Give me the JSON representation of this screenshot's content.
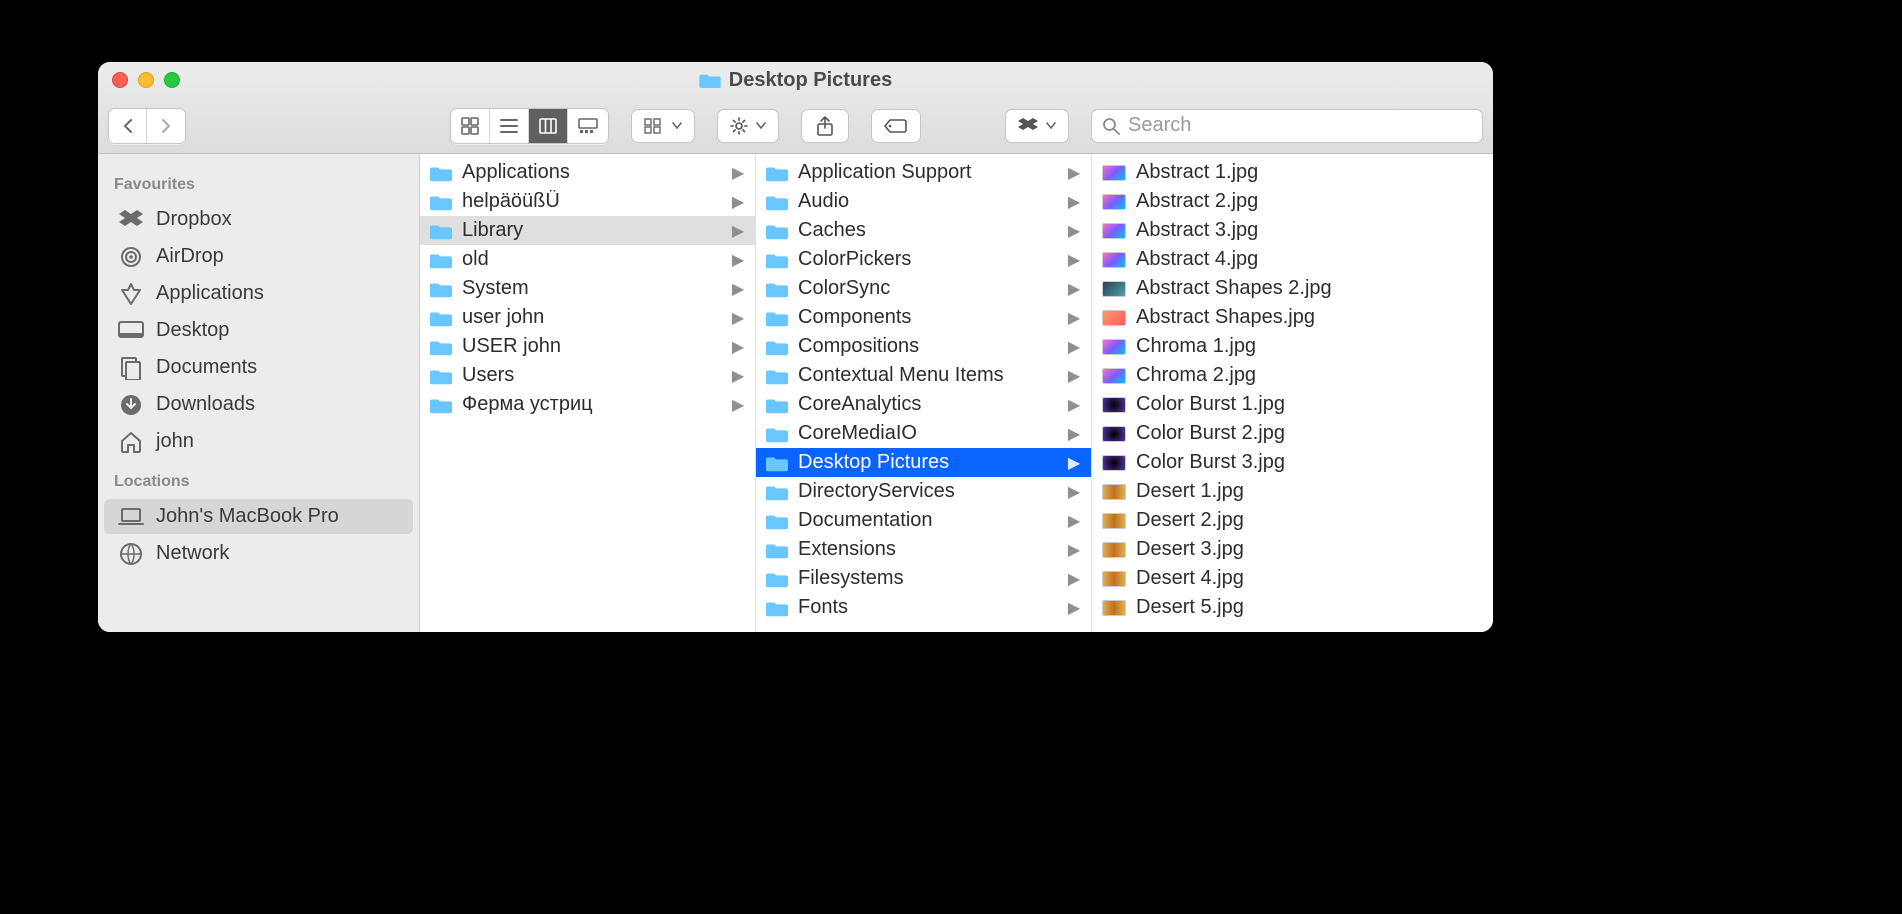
{
  "window": {
    "title": "Desktop Pictures"
  },
  "search": {
    "placeholder": "Search"
  },
  "sidebar": {
    "sections": [
      {
        "heading": "Favourites",
        "items": [
          {
            "icon": "dropbox",
            "label": "Dropbox"
          },
          {
            "icon": "airdrop",
            "label": "AirDrop"
          },
          {
            "icon": "apps",
            "label": "Applications"
          },
          {
            "icon": "desktop",
            "label": "Desktop"
          },
          {
            "icon": "docs",
            "label": "Documents"
          },
          {
            "icon": "downloads",
            "label": "Downloads"
          },
          {
            "icon": "home",
            "label": "john"
          }
        ]
      },
      {
        "heading": "Locations",
        "items": [
          {
            "icon": "laptop",
            "label": "John's MacBook Pro",
            "selected": true
          },
          {
            "icon": "globe",
            "label": "Network"
          }
        ]
      }
    ]
  },
  "columns": [
    {
      "items": [
        {
          "type": "folder",
          "label": "Applications"
        },
        {
          "type": "folder",
          "label": "helpäöüßÜ"
        },
        {
          "type": "folder",
          "label": "Library",
          "selected": "dim"
        },
        {
          "type": "folder",
          "label": "old"
        },
        {
          "type": "folder",
          "label": "System"
        },
        {
          "type": "folder",
          "label": "user john"
        },
        {
          "type": "folder",
          "label": "USER john"
        },
        {
          "type": "folder",
          "label": "Users"
        },
        {
          "type": "folder",
          "label": "Ферма устриц"
        }
      ]
    },
    {
      "items": [
        {
          "type": "folder",
          "label": "Application Support"
        },
        {
          "type": "folder",
          "label": "Audio"
        },
        {
          "type": "folder",
          "label": "Caches"
        },
        {
          "type": "folder",
          "label": "ColorPickers"
        },
        {
          "type": "folder",
          "label": "ColorSync"
        },
        {
          "type": "folder",
          "label": "Components"
        },
        {
          "type": "folder",
          "label": "Compositions"
        },
        {
          "type": "folder",
          "label": "Contextual Menu Items"
        },
        {
          "type": "folder",
          "label": "CoreAnalytics"
        },
        {
          "type": "folder",
          "label": "CoreMediaIO"
        },
        {
          "type": "folder",
          "label": "Desktop Pictures",
          "selected": "active"
        },
        {
          "type": "folder",
          "label": "DirectoryServices"
        },
        {
          "type": "folder",
          "label": "Documentation"
        },
        {
          "type": "folder",
          "label": "Extensions"
        },
        {
          "type": "folder",
          "label": "Filesystems"
        },
        {
          "type": "folder",
          "label": "Fonts"
        }
      ]
    },
    {
      "items": [
        {
          "type": "image",
          "thumb": "t1",
          "label": "Abstract 1.jpg"
        },
        {
          "type": "image",
          "thumb": "t1",
          "label": "Abstract 2.jpg"
        },
        {
          "type": "image",
          "thumb": "t1",
          "label": "Abstract 3.jpg"
        },
        {
          "type": "image",
          "thumb": "t1",
          "label": "Abstract 4.jpg"
        },
        {
          "type": "image",
          "thumb": "t5",
          "label": "Abstract Shapes 2.jpg"
        },
        {
          "type": "image",
          "thumb": "t2",
          "label": "Abstract Shapes.jpg"
        },
        {
          "type": "image",
          "thumb": "t1",
          "label": "Chroma 1.jpg"
        },
        {
          "type": "image",
          "thumb": "t1",
          "label": "Chroma 2.jpg"
        },
        {
          "type": "image",
          "thumb": "t3",
          "label": "Color Burst 1.jpg"
        },
        {
          "type": "image",
          "thumb": "t3",
          "label": "Color Burst 2.jpg"
        },
        {
          "type": "image",
          "thumb": "t3",
          "label": "Color Burst 3.jpg"
        },
        {
          "type": "image",
          "thumb": "t4",
          "label": "Desert 1.jpg"
        },
        {
          "type": "image",
          "thumb": "t4",
          "label": "Desert 2.jpg"
        },
        {
          "type": "image",
          "thumb": "t4",
          "label": "Desert 3.jpg"
        },
        {
          "type": "image",
          "thumb": "t4",
          "label": "Desert 4.jpg"
        },
        {
          "type": "image",
          "thumb": "t4",
          "label": "Desert 5.jpg"
        }
      ]
    }
  ]
}
